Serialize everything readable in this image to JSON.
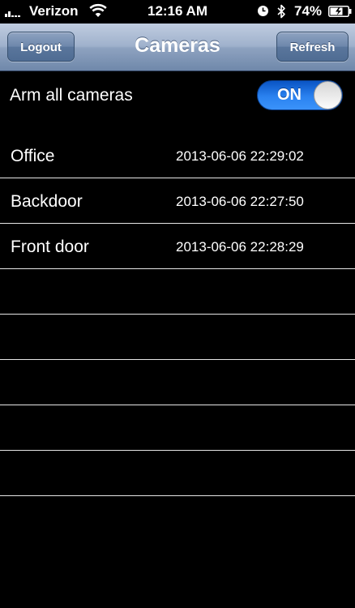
{
  "status_bar": {
    "carrier": "Verizon",
    "time": "12:16 AM",
    "battery_percent": "74%",
    "icons": [
      "signal-icon",
      "wifi-icon",
      "clock-icon",
      "bluetooth-icon",
      "battery-icon"
    ]
  },
  "nav": {
    "title": "Cameras",
    "left_button": "Logout",
    "right_button": "Refresh"
  },
  "arm": {
    "label": "Arm all cameras",
    "toggle_label": "ON",
    "toggle_on": true,
    "toggle_color": "#2a82f0"
  },
  "cameras": [
    {
      "name": "Office",
      "timestamp": "2013-06-06 22:29:02"
    },
    {
      "name": "Backdoor",
      "timestamp": "2013-06-06 22:27:50"
    },
    {
      "name": "Front door",
      "timestamp": "2013-06-06 22:28:29"
    },
    {
      "name": "",
      "timestamp": ""
    },
    {
      "name": "",
      "timestamp": ""
    },
    {
      "name": "",
      "timestamp": ""
    },
    {
      "name": "",
      "timestamp": ""
    },
    {
      "name": "",
      "timestamp": ""
    }
  ]
}
